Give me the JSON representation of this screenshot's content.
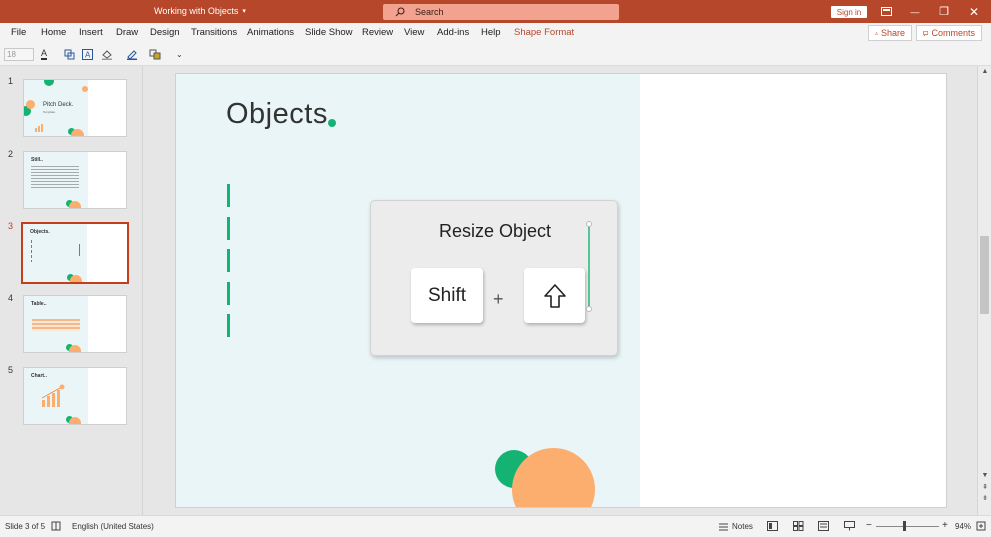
{
  "titlebar": {
    "doc_title": "Working with Objects",
    "doc_title_caret": "▾",
    "search_placeholder": "Search",
    "sign_in": "Sign in",
    "ribbon_icon": "ribbon-display-icon",
    "minimize": "—",
    "restore": "❐",
    "close": "✕"
  },
  "menu": {
    "items": [
      "File",
      "Home",
      "Insert",
      "Draw",
      "Design",
      "Transitions",
      "Animations",
      "Slide Show",
      "Review",
      "View",
      "Add-ins",
      "Help",
      "Shape Format"
    ],
    "share": "Share",
    "comments": "Comments"
  },
  "toolbar": {
    "font_size": "18",
    "font_color_icon": "A",
    "more": "⌄"
  },
  "thumbnails": [
    {
      "number": "1",
      "title": "Pitch Deck.",
      "subtitle": "Template"
    },
    {
      "number": "2",
      "title": "Still.."
    },
    {
      "number": "3",
      "title": "Objects."
    },
    {
      "number": "4",
      "title": "Table.."
    },
    {
      "number": "5",
      "title": "Chart.."
    }
  ],
  "active_slide": 3,
  "slide": {
    "title": "Objects",
    "card_title": "Resize Object",
    "shift_key": "Shift",
    "plus": "+"
  },
  "status": {
    "slide_info": "Slide 3 of 5",
    "language": "English (United States)",
    "notes": "Notes",
    "zoom_minus": "−",
    "zoom_plus": "+",
    "zoom": "94%"
  },
  "colors": {
    "accent": "#b7472a",
    "green": "#15b373",
    "orange": "#fbae6e",
    "slide_panel": "#eaf5f7"
  }
}
